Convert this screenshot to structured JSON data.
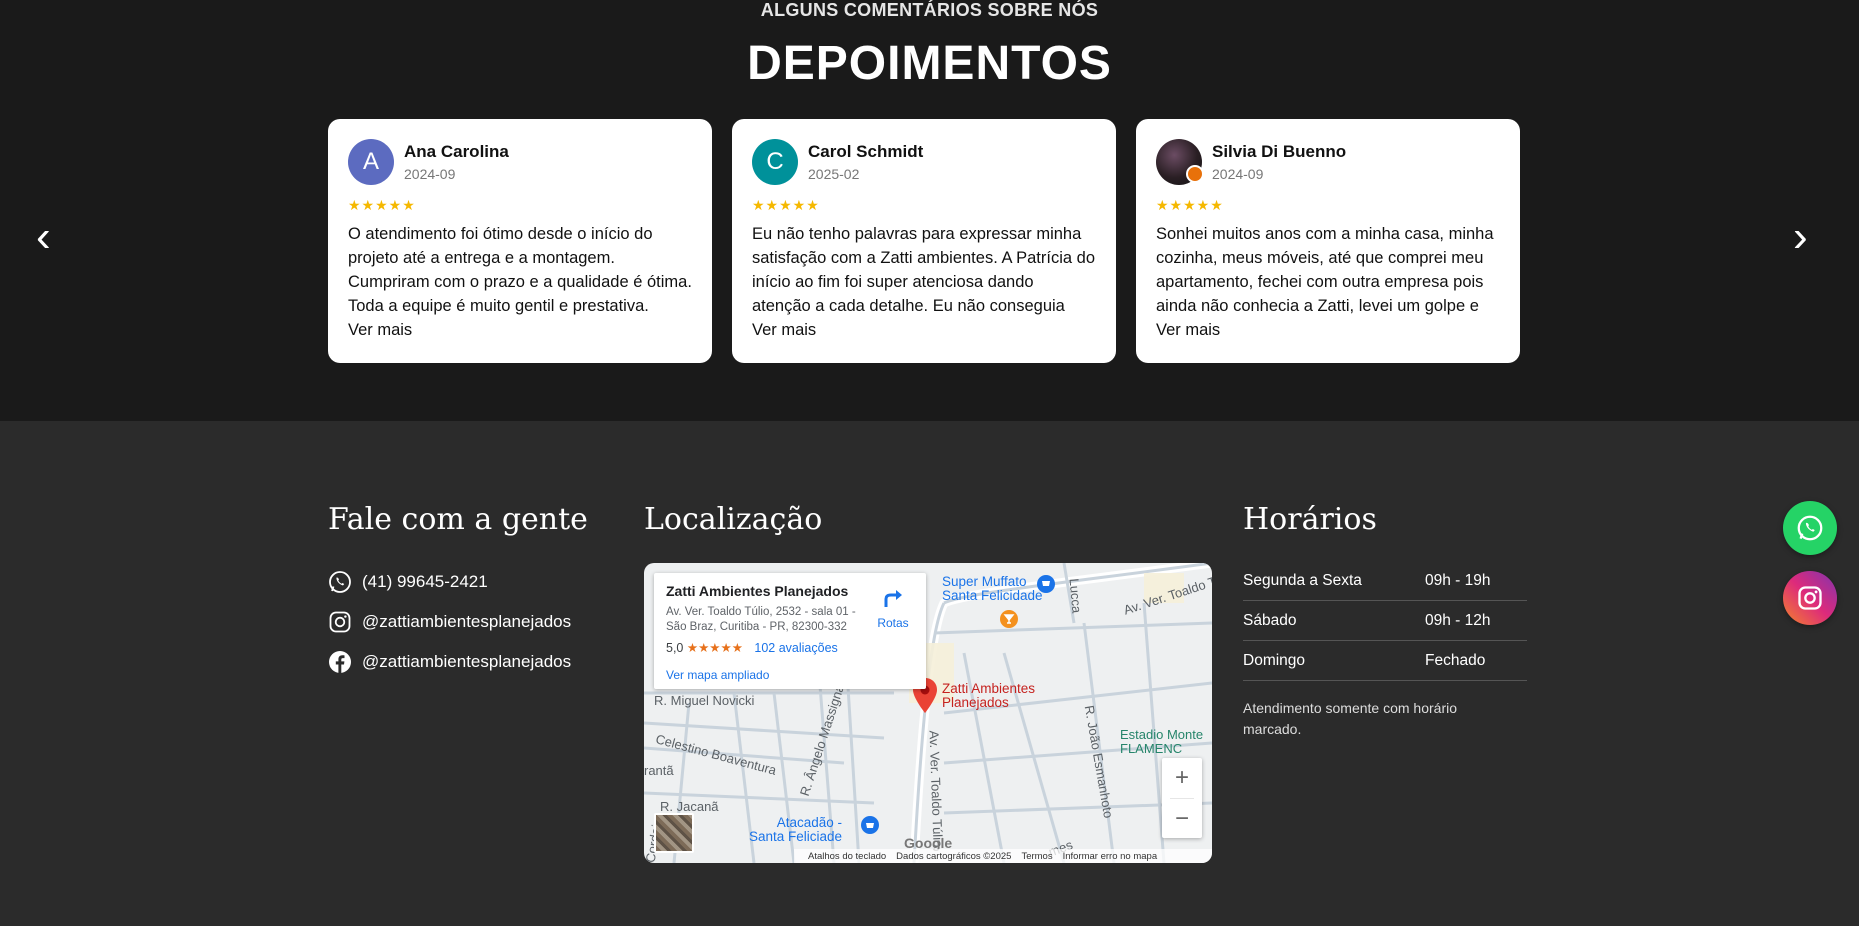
{
  "testimonials": {
    "kicker": "ALGUNS COMENTÁRIOS SOBRE NÓS",
    "title": "DEPOIMENTOS",
    "prev_arrow": "‹",
    "next_arrow": "›",
    "reviews": [
      {
        "initial": "A",
        "avatar_color": "#5c6bc0",
        "name": "Ana Carolina",
        "date": "2024-09",
        "stars": "★★★★★",
        "text": "O atendimento foi ótimo desde o início do projeto até a entrega e a montagem. Cumpriram com o prazo e a qualidade é ótima. Toda a equipe é muito gentil e prestativa. Super",
        "more": "Ver mais"
      },
      {
        "initial": "C",
        "avatar_color": "#00919a",
        "name": "Carol Schmidt",
        "date": "2025-02",
        "stars": "★★★★★",
        "text": "Eu não tenho palavras para expressar minha satisfação com a Zatti ambientes. A Patrícia do início ao fim foi super atenciosa dando atenção a cada detalhe. Eu não conseguia fechar minha",
        "more": "Ver mais"
      },
      {
        "initial": "",
        "avatar_color": "#2a1f24",
        "name": "Silvia Di Buenno",
        "date": "2024-09",
        "stars": "★★★★★",
        "text": "Sonhei muitos anos com a minha casa, minha cozinha, meus móveis, até que comprei meu apartamento, fechei com outra empresa pois ainda não conhecia a Zatti, levei um golpe e",
        "more": "Ver mais"
      }
    ]
  },
  "contact": {
    "title": "Fale com a gente",
    "phone": "(41) 99645-2421",
    "instagram": "@zattiambientesplanejados",
    "facebook": "@zattiambientesplanejados"
  },
  "location": {
    "title": "Localização",
    "map": {
      "place_name": "Zatti Ambientes Planejados",
      "address": "Av. Ver. Toaldo Túlio, 2532 - sala 01 - São Braz, Curitiba - PR, 82300-332",
      "rating": "5,0",
      "rating_stars": "★★★★★",
      "reviews_link": "102 avaliações",
      "larger_map_link": "Ver mapa ampliado",
      "directions_label": "Rotas",
      "pin_label_line1": "Zatti Ambientes",
      "pin_label_line2": "Planejados",
      "poi_market_line1": "Super Muffato",
      "poi_market_line2": "Santa Felicidade",
      "poi_atacadao_line1": "Atacadão -",
      "poi_atacadao_line2": "Santa Feliciade",
      "poi_stadium_line1": "Estadio Monte",
      "poi_stadium_line2": "FLAMENC",
      "street_1": "Av. Ver. Toaldo Túlio",
      "street_2": "R. Miguel Novicki",
      "street_3": "Celestino Boaventura",
      "street_4": "R. Ângelo Massigna",
      "street_5": "Av. Ver. Toaldo Túlio",
      "street_6": "R. João Esmanhoto",
      "street_7": "R. Jacanã",
      "street_8": "rantã",
      "street_9": "Cordeiro",
      "street_10": "Lucca",
      "street_11": "mes",
      "zoom_in": "+",
      "zoom_out": "−",
      "google": "Google",
      "footer_shortcuts": "Atalhos do teclado",
      "footer_data": "Dados cartográficos ©2025",
      "footer_terms": "Termos",
      "footer_report": "Informar erro no mapa"
    }
  },
  "hours": {
    "title": "Horários",
    "rows": [
      {
        "day": "Segunda a Sexta",
        "time": "09h - 19h"
      },
      {
        "day": "Sábado",
        "time": "09h - 12h"
      },
      {
        "day": "Domingo",
        "time": "Fechado"
      }
    ],
    "note": "Atendimento somente com horário marcado."
  },
  "floating": {
    "whatsapp_color": "#25d366",
    "instagram_color": "#dd2a7b"
  },
  "icons": [
    "whatsapp-icon",
    "instagram-icon",
    "facebook-icon",
    "directions-icon",
    "map-pin-icon",
    "shopping-icon",
    "cocktail-icon"
  ]
}
